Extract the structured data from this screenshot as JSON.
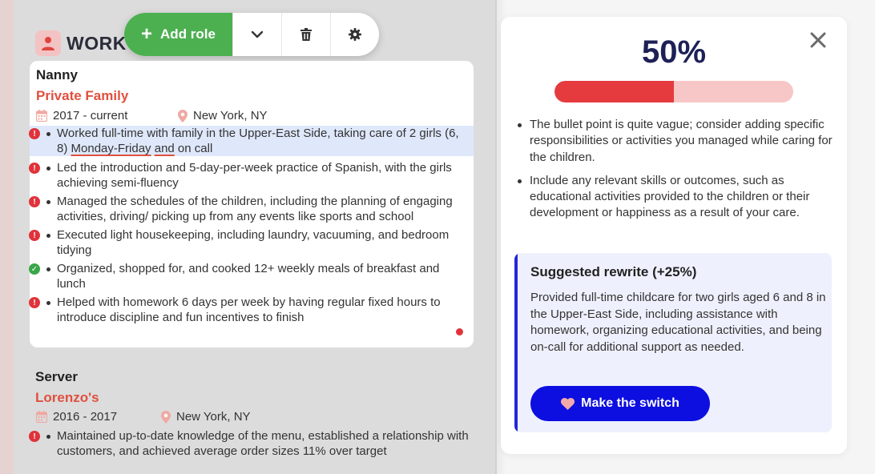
{
  "toolbar": {
    "add_role_label": "Add role",
    "icons": [
      "chevron-down-icon",
      "trash-icon",
      "gear-icon"
    ]
  },
  "section": {
    "title": "WORK",
    "icon": "person-icon"
  },
  "jobs": [
    {
      "title": "Nanny",
      "company": "Private Family",
      "dates": "2017 - current",
      "location": "New York, NY",
      "bullets": [
        {
          "status": "error",
          "text": "Worked full-time with family in the Upper-East Side, taking care of 2 girls (6, 8) Monday-Friday and on call"
        },
        {
          "status": "error",
          "text": "Led the introduction and 5-day-per-week practice of Spanish, with the girls achieving semi-fluency"
        },
        {
          "status": "error",
          "text": "Managed the schedules of the children, including the planning of engaging activities, driving/ picking up from any events like sports and school"
        },
        {
          "status": "error",
          "text": "Executed light housekeeping, including laundry, vacuuming, and bedroom tidying"
        },
        {
          "status": "ok",
          "text": "Organized, shopped for, and cooked 12+ weekly meals of breakfast and lunch"
        },
        {
          "status": "error",
          "text": "Helped with homework 6 days per week by having regular fixed hours to introduce discipline and fun incentives to finish"
        }
      ]
    },
    {
      "title": "Server",
      "company": "Lorenzo's",
      "dates": "2016 - 2017",
      "location": "New York, NY",
      "bullets": [
        {
          "status": "error",
          "text": "Maintained up-to-date knowledge of the menu, established a relationship with customers, and achieved average order sizes 11% over target"
        }
      ]
    }
  ],
  "panel": {
    "score": "50%",
    "progress_fraction": 0.5,
    "feedback": [
      "The bullet point is quite vague; consider adding specific responsibilities or activities you managed while caring for the children.",
      "Include any relevant skills or outcomes, such as educational activities provided to the children or their development or happiness as a result of your care."
    ],
    "suggestion": {
      "title": "Suggested rewrite (+25%)",
      "text": "Provided full-time childcare for two girls aged 6 and 8 in the Upper-East Side, including assistance with homework, organizing educational activities, and being on-call for additional support as needed.",
      "button_label": "Make the switch"
    }
  },
  "colors": {
    "accent_green": "#4cb050",
    "company_red": "#e0503f",
    "error_red": "#e0323a",
    "ok_green": "#3aa64a",
    "progress_fill": "#e53b3f",
    "progress_track": "#f7c6c6",
    "primary_blue": "#0d0ee0",
    "score_navy": "#1e2157"
  }
}
